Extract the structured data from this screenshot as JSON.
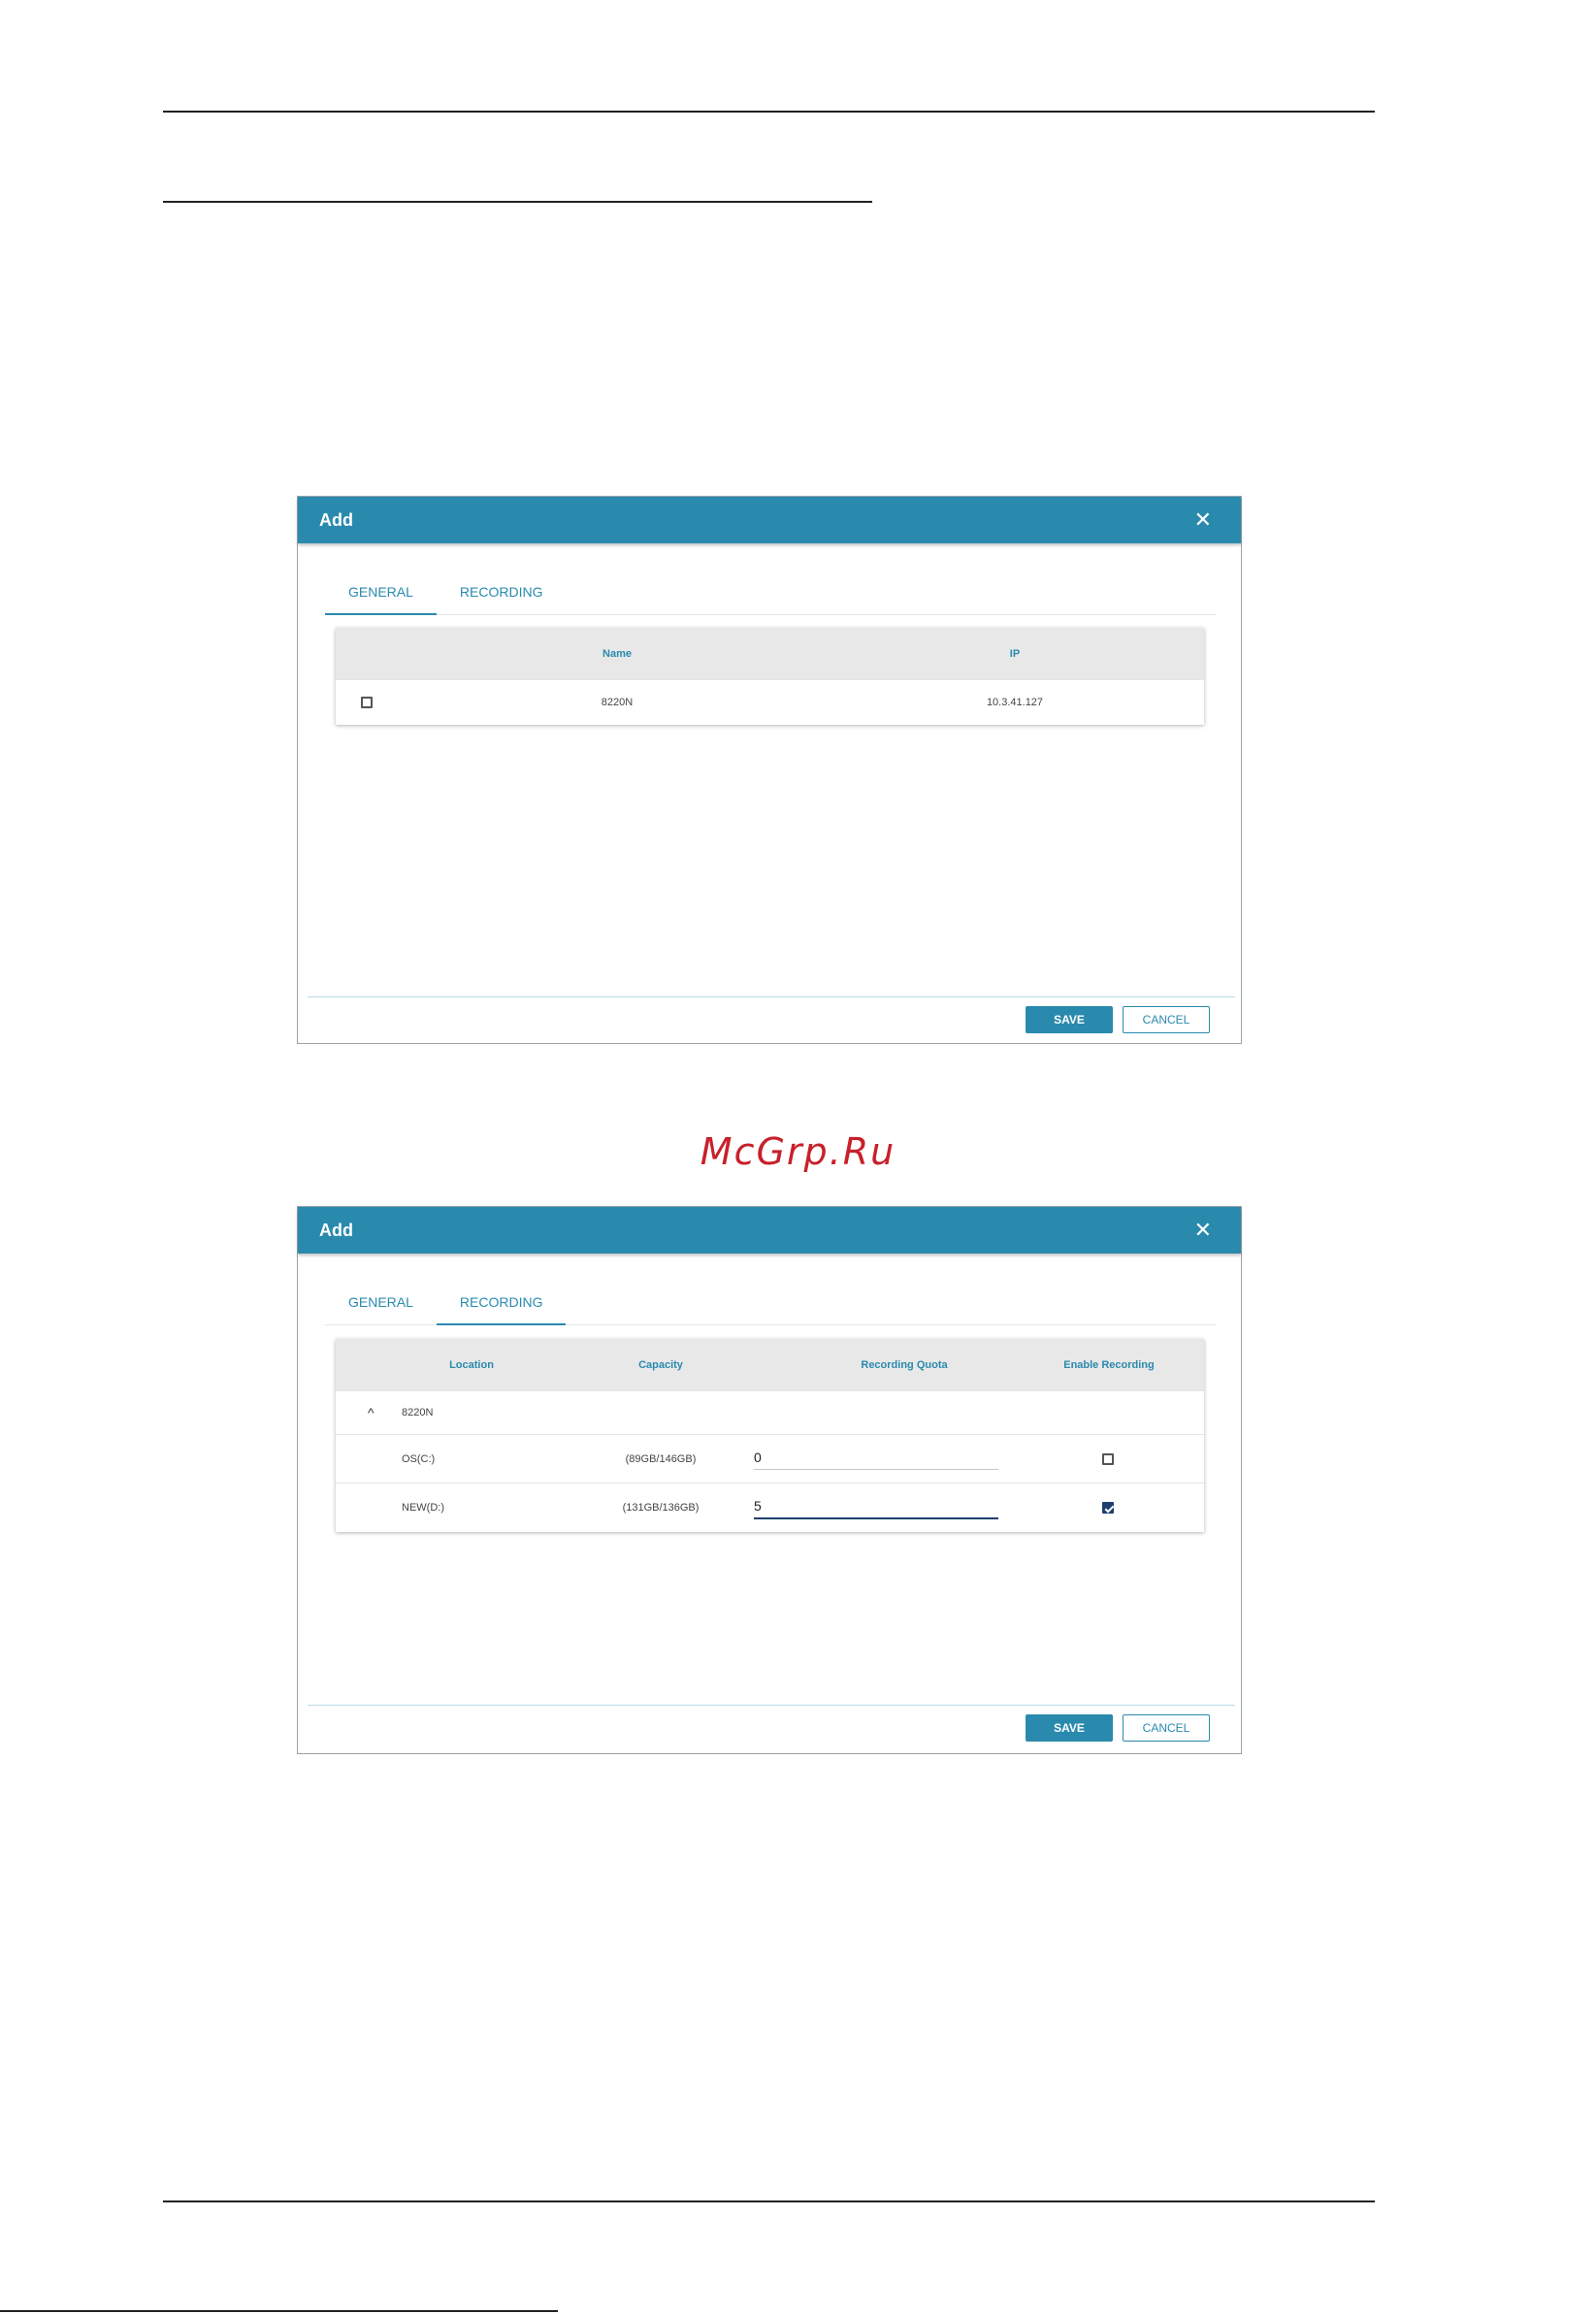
{
  "watermark": "McGrp.Ru",
  "dialog1": {
    "title": "Add",
    "close_glyph": "✕",
    "tabs": [
      {
        "label": "GENERAL",
        "active": true
      },
      {
        "label": "RECORDING",
        "active": false
      }
    ],
    "columns": {
      "name": "Name",
      "ip": "IP"
    },
    "rows": [
      {
        "checked": false,
        "name": "8220N",
        "ip": "10.3.41.127"
      }
    ],
    "save_label": "SAVE",
    "cancel_label": "CANCEL"
  },
  "dialog2": {
    "title": "Add",
    "close_glyph": "✕",
    "tabs": [
      {
        "label": "GENERAL",
        "active": false
      },
      {
        "label": "RECORDING",
        "active": true
      }
    ],
    "columns": {
      "location": "Location",
      "capacity": "Capacity",
      "quota": "Recording Quota",
      "enable": "Enable Recording"
    },
    "group": {
      "expand_glyph": "^",
      "name": "8220N"
    },
    "rows": [
      {
        "location": "OS(C:)",
        "capacity": "(89GB/146GB)",
        "quota": "0",
        "enabled": false
      },
      {
        "location": "NEW(D:)",
        "capacity": "(131GB/136GB)",
        "quota": "5",
        "enabled": true
      }
    ],
    "save_label": "SAVE",
    "cancel_label": "CANCEL"
  }
}
